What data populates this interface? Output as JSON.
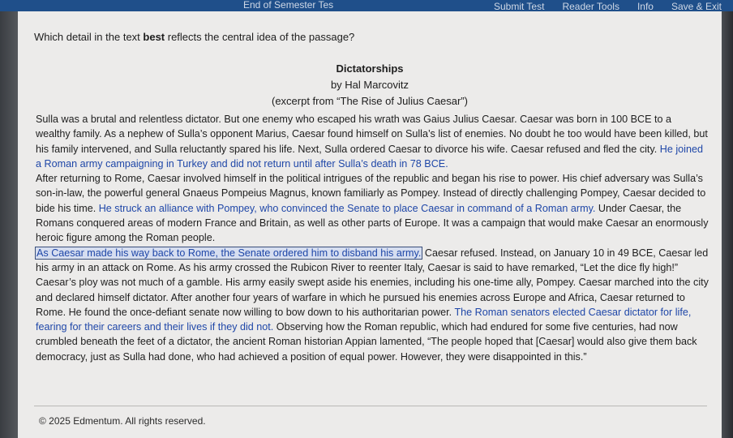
{
  "toolbar": {
    "title": "End of Semester Tes",
    "submit_label": "Submit Test",
    "reader_tools_label": "Reader Tools",
    "info_label": "Info",
    "save_exit_label": "Save & Exit"
  },
  "question": {
    "prefix": "Which detail in the text ",
    "emphasis": "best",
    "suffix": " reflects the central idea of the passage?"
  },
  "passage": {
    "title": "Dictatorships",
    "byline": "by Hal Marcovitz",
    "excerpt_note": "(excerpt from “The Rise of Julius Caesar”)",
    "p1_a": "Sulla was a brutal and relentless dictator. But one enemy who escaped his wrath was Gaius Julius Caesar. Caesar was born in 100 BCE to a wealthy family. As a nephew of Sulla’s opponent Marius, Caesar found himself on Sulla’s list of enemies. No doubt he too would have been killed, but his family intervened, and Sulla reluctantly spared his life. Next, Sulla ordered Caesar to divorce his wife. Caesar refused and fled the city. ",
    "p1_option": "He joined a Roman army campaigning in Turkey and did not return until after Sulla’s death in 78 BCE.",
    "p2_a": "After returning to Rome, Caesar involved himself in the political intrigues of the republic and began his rise to power. His chief adversary was Sulla’s son-in-law, the powerful general Gnaeus Pompeius Magnus, known familiarly as Pompey. Instead of directly challenging Pompey, Caesar decided to bide his time. ",
    "p2_option": "He struck an alliance with Pompey, who convinced the Senate to place Caesar in command of a Roman army.",
    "p2_b": " Under Caesar, the Romans conquered areas of modern France and Britain, as well as other parts of Europe. It was a campaign that would make Caesar an enormously heroic figure among the Roman people.",
    "p3_option_selected": "As Caesar made his way back to Rome, the Senate ordered him to disband his army.",
    "p3_a": " Caesar refused. Instead, on January 10 in 49 BCE, Caesar led his army in an attack on Rome. As his army crossed the Rubicon River to reenter Italy, Caesar is said to have remarked, “Let the dice fly high!” Caesar’s ploy was not much of a gamble. His army easily swept aside his enemies, including his one-time ally, Pompey. Caesar marched into the city and declared himself dictator. After another four years of warfare in which he pursued his enemies across Europe and Africa, Caesar returned to Rome. He found the once-defiant senate now willing to bow down to his authoritarian power. ",
    "p3_option": "The Roman senators elected Caesar dictator for life, fearing for their careers and their lives if they did not.",
    "p3_b": " Observing how the Roman republic, which had endured for some five centuries, had now crumbled beneath the feet of a dictator, the ancient Roman historian Appian lamented, “The people hoped that [Caesar] would also give them back democracy, just as Sulla had done, who had achieved a position of equal power. However, they were disappointed in this.”"
  },
  "footer": {
    "copyright": "© 2025 Edmentum. All rights reserved."
  },
  "colors": {
    "option_text": "#1f47a8",
    "selected_box_bg": "#d6def0",
    "panel_bg": "#ecebea"
  }
}
